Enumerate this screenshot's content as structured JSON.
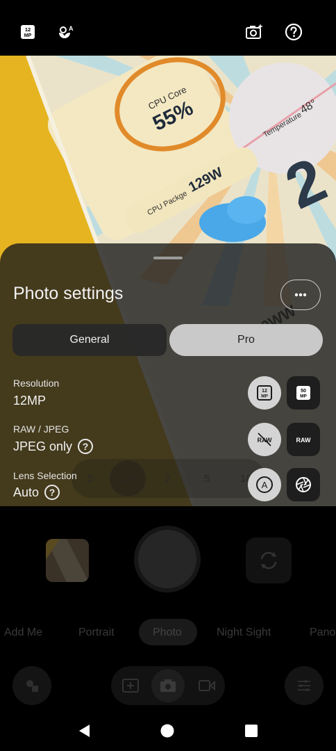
{
  "topbar": {
    "resolution_badge_text": "12 MP",
    "icons": [
      "megapixel-icon",
      "auto-enhance-icon",
      "camera-settings-icon",
      "help-icon"
    ]
  },
  "viewfinder": {
    "cpu_core_label": "CPU Core",
    "cpu_core_value": "55%",
    "temperature_label": "Temperature",
    "temperature_value": "48°",
    "cpu_package_label": "CPU Packge",
    "cpu_package_value": "129W",
    "partial_big_number": "2",
    "partial_text": "0WW"
  },
  "settings": {
    "title": "Photo settings",
    "tabs": [
      {
        "label": "General",
        "active": false
      },
      {
        "label": "Pro",
        "active": true
      }
    ],
    "rows": [
      {
        "label": "Resolution",
        "value": "12MP",
        "options": [
          "12 MP",
          "50 MP"
        ],
        "selected": 0
      },
      {
        "label": "RAW / JPEG",
        "value": "JPEG only",
        "options": [
          "RAW off",
          "RAW"
        ],
        "selected": 0
      },
      {
        "label": "Lens Selection",
        "value": "Auto",
        "options": [
          "A",
          "aperture"
        ],
        "selected": 0
      }
    ]
  },
  "zoom": {
    "levels": [
      ".5",
      "1×",
      "2",
      "5",
      "10"
    ],
    "selected": "1×"
  },
  "modes": {
    "items": [
      "Add Me",
      "Portrait",
      "Photo",
      "Night Sight",
      "Pano"
    ],
    "active": "Photo"
  }
}
